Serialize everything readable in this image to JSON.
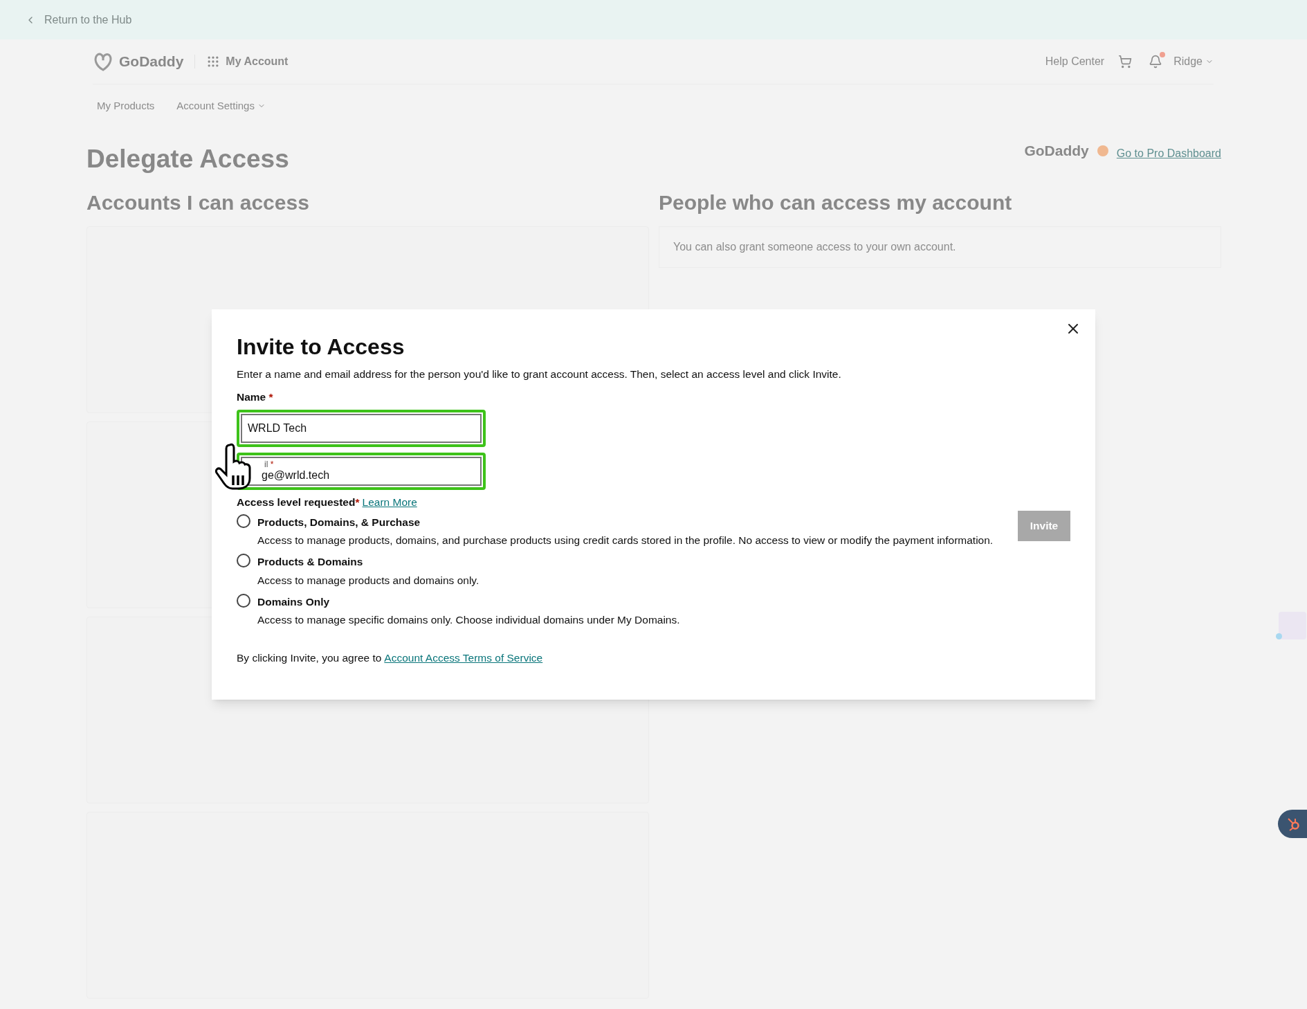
{
  "top_bar": {
    "back_link": "Return to the Hub"
  },
  "header": {
    "logo": "GoDaddy",
    "app": "My Account",
    "help": "Help Center",
    "user": "Ridge",
    "notification": true
  },
  "nav": [
    {
      "label": "My Products",
      "dropdown": false
    },
    {
      "label": "Account Settings",
      "dropdown": true
    }
  ],
  "page": {
    "title": "Delegate Access",
    "pro_logo": "GoDaddy",
    "pro_link": "Go to Pro Dashboard",
    "left_heading": "Accounts I can access",
    "right_heading": "People who can access my account",
    "right_note": "You can also grant someone access to your own account."
  },
  "dialog": {
    "title": "Invite to Access",
    "intro": "Enter a name and email address for the person you'd like to grant account access. Then, select an access level and click Invite.",
    "fields": [
      {
        "label": "Name",
        "required": true,
        "required_mark": "*",
        "value": "WRLD Tech"
      },
      {
        "label": "il",
        "required": true,
        "required_mark": "*",
        "value": "ge@wrld.tech"
      }
    ],
    "access_label": "Access level requested",
    "access_mark": "*",
    "access_link": "Learn More",
    "options": [
      {
        "title": "Products, Domains, & Purchase",
        "description": "Access to manage products, domains, and purchase products using credit cards stored in the profile. No access to view or modify the payment information.",
        "selected": false
      },
      {
        "title": "Products & Domains",
        "description": "Access to manage products and domains only.",
        "selected": false
      },
      {
        "title": "Domains Only",
        "description": "Access to manage specific domains only. Choose individual domains under My Domains.",
        "selected": false
      }
    ],
    "invite_button": {
      "label": "Invite",
      "disabled": true
    },
    "terms_text": "By clicking Invite, you agree to",
    "terms_link": "Account Access Terms of Service"
  }
}
